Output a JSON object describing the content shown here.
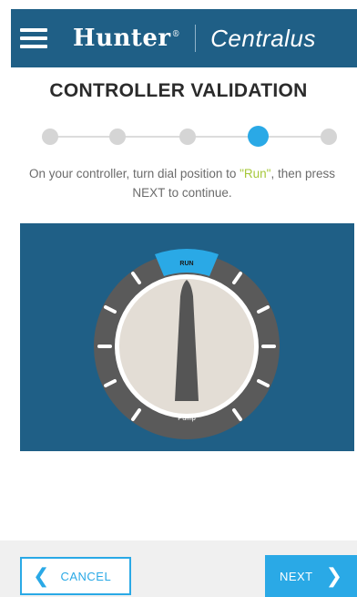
{
  "header": {
    "brand": "Hunter",
    "brand_mark": "®",
    "product": "Centralus",
    "menu_icon": "hamburger-menu-icon"
  },
  "page": {
    "title": "CONTROLLER VALIDATION"
  },
  "stepper": {
    "total_steps": 5,
    "current_step": 4
  },
  "instruction": {
    "before": "On your controller, turn dial position to ",
    "highlight": "\"Run\"",
    "after": ", then press NEXT to continue."
  },
  "dial": {
    "top_label": "RUN",
    "bottom_label": "Pump"
  },
  "footer": {
    "cancel_label": "CANCEL",
    "next_label": "NEXT"
  },
  "colors": {
    "brand_blue": "#1f5f86",
    "accent_blue": "#2aa9e6",
    "highlight_green": "#a6c83a"
  }
}
